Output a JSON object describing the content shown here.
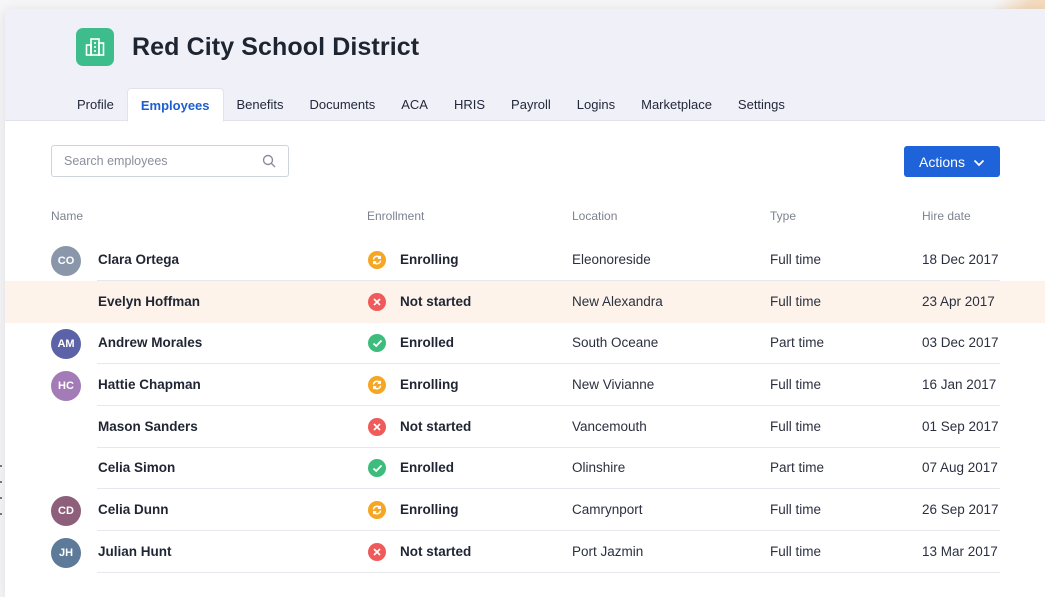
{
  "app": {
    "title": "Red City School District",
    "brand_color": "#3dbd8b",
    "accent_color": "#1e63d9"
  },
  "tabs": [
    {
      "label": "Profile",
      "active": false
    },
    {
      "label": "Employees",
      "active": true
    },
    {
      "label": "Benefits",
      "active": false
    },
    {
      "label": "Documents",
      "active": false
    },
    {
      "label": "ACA",
      "active": false
    },
    {
      "label": "HRIS",
      "active": false
    },
    {
      "label": "Payroll",
      "active": false
    },
    {
      "label": "Logins",
      "active": false
    },
    {
      "label": "Marketplace",
      "active": false
    },
    {
      "label": "Settings",
      "active": false
    }
  ],
  "search": {
    "placeholder": "Search employees",
    "value": ""
  },
  "actions": {
    "label": "Actions",
    "icon": "chevron-down-icon"
  },
  "table": {
    "columns": {
      "name": "Name",
      "enrollment": "Enrollment",
      "location": "Location",
      "type": "Type",
      "hire_date": "Hire date"
    },
    "rows": [
      {
        "initials": "CO",
        "avatar_color": "#8a97ab",
        "name": "Clara Ortega",
        "status_kind": "enrolling",
        "status": "Enrolling",
        "location": "Eleonoreside",
        "type": "Full time",
        "hire_date": "18 Dec 2017",
        "highlight": false
      },
      {
        "initials": "",
        "avatar_color": "",
        "name": "Evelyn Hoffman",
        "status_kind": "not-started",
        "status": "Not started",
        "location": "New Alexandra",
        "type": "Full time",
        "hire_date": "23 Apr 2017",
        "highlight": true
      },
      {
        "initials": "AM",
        "avatar_color": "#5b62a8",
        "name": "Andrew Morales",
        "status_kind": "enrolled",
        "status": "Enrolled",
        "location": "South Oceane",
        "type": "Part time",
        "hire_date": "03 Dec 2017",
        "highlight": false
      },
      {
        "initials": "HC",
        "avatar_color": "#a27bb7",
        "name": "Hattie Chapman",
        "status_kind": "enrolling",
        "status": "Enrolling",
        "location": "New Vivianne",
        "type": "Full time",
        "hire_date": "16 Jan 2017",
        "highlight": false
      },
      {
        "initials": "",
        "avatar_color": "",
        "name": "Mason Sanders",
        "status_kind": "not-started",
        "status": "Not started",
        "location": "Vancemouth",
        "type": "Full time",
        "hire_date": "01 Sep 2017",
        "highlight": false
      },
      {
        "initials": "",
        "avatar_color": "",
        "name": "Celia Simon",
        "status_kind": "enrolled",
        "status": "Enrolled",
        "location": "Olinshire",
        "type": "Part time",
        "hire_date": "07 Aug 2017",
        "highlight": false
      },
      {
        "initials": "CD",
        "avatar_color": "#8e5f7a",
        "name": "Celia Dunn",
        "status_kind": "enrolling",
        "status": "Enrolling",
        "location": "Camrynport",
        "type": "Full time",
        "hire_date": "26 Sep 2017",
        "highlight": false
      },
      {
        "initials": "JH",
        "avatar_color": "#5d7a99",
        "name": "Julian Hunt",
        "status_kind": "not-started",
        "status": "Not started",
        "location": "Port Jazmin",
        "type": "Full time",
        "hire_date": "13 Mar 2017",
        "highlight": false
      }
    ]
  },
  "status_colors": {
    "enrolling": "#f5a623",
    "not-started": "#ef5a5a",
    "enrolled": "#3dbd7d"
  }
}
